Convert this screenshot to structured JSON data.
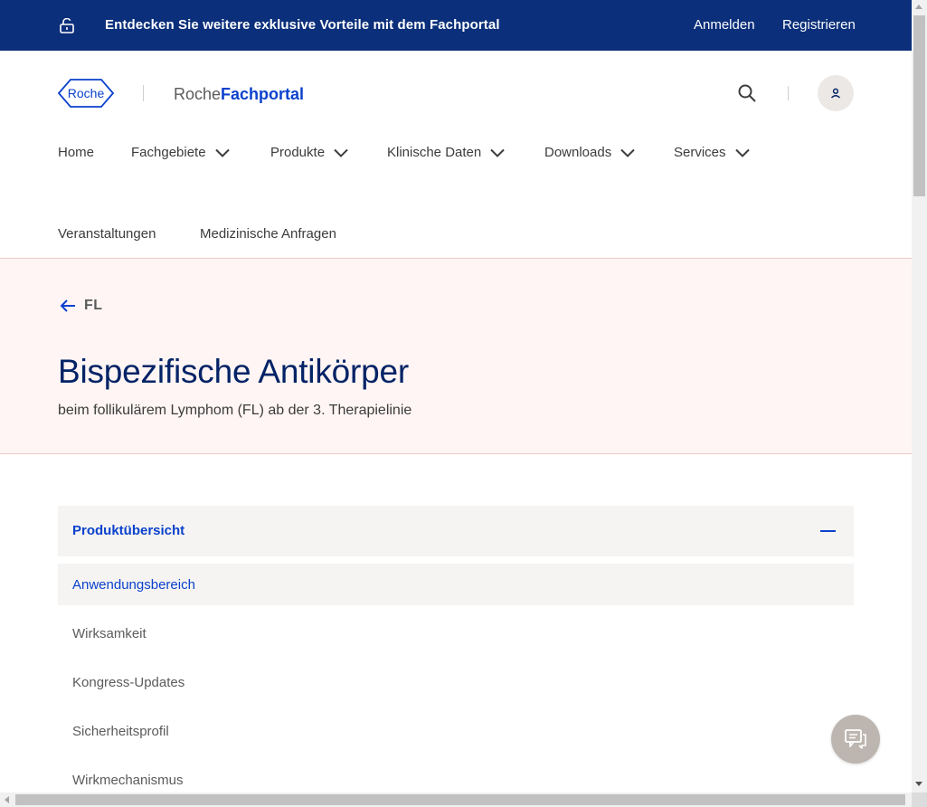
{
  "banner": {
    "promo_text": "Entdecken Sie weitere exklusive Vorteile mit dem Fachportal",
    "login_label": "Anmelden",
    "register_label": "Registrieren",
    "icon": "lock-open-icon"
  },
  "header": {
    "logo_text": "Roche",
    "portal_name_thin": "Roche",
    "portal_name_bold": "Fachportal",
    "search_icon": "search-icon",
    "user_icon": "user-icon"
  },
  "nav": {
    "items": [
      {
        "label": "Home",
        "has_dropdown": false
      },
      {
        "label": "Fachgebiete",
        "has_dropdown": true
      },
      {
        "label": "Produkte",
        "has_dropdown": true
      },
      {
        "label": "Klinische Daten",
        "has_dropdown": true
      },
      {
        "label": "Downloads",
        "has_dropdown": true
      },
      {
        "label": "Services",
        "has_dropdown": true
      },
      {
        "label": "Veranstaltungen",
        "has_dropdown": false
      },
      {
        "label": "Medizinische Anfragen",
        "has_dropdown": false
      }
    ]
  },
  "hero": {
    "back_label": "FL",
    "title": "Bispezifische Antikörper",
    "subtitle": "beim follikulärem Lymphom (FL) ab der 3. Therapielinie"
  },
  "accordion": {
    "heading": "Produktübersicht",
    "expanded": true,
    "items": [
      {
        "label": "Anwendungsbereich",
        "active": true
      },
      {
        "label": "Wirksamkeit",
        "active": false
      },
      {
        "label": "Kongress-Updates",
        "active": false
      },
      {
        "label": "Sicherheitsprofil",
        "active": false
      },
      {
        "label": "Wirkmechanismus",
        "active": false
      }
    ]
  },
  "chat": {
    "icon": "chat-icon"
  },
  "colors": {
    "banner_bg": "#0b2f7a",
    "brand_blue": "#0b41cd",
    "title_navy": "#022366",
    "hero_bg": "#fff5f4",
    "accordion_bg": "#f5f4f2",
    "fab_bg": "#bdb6b0"
  }
}
